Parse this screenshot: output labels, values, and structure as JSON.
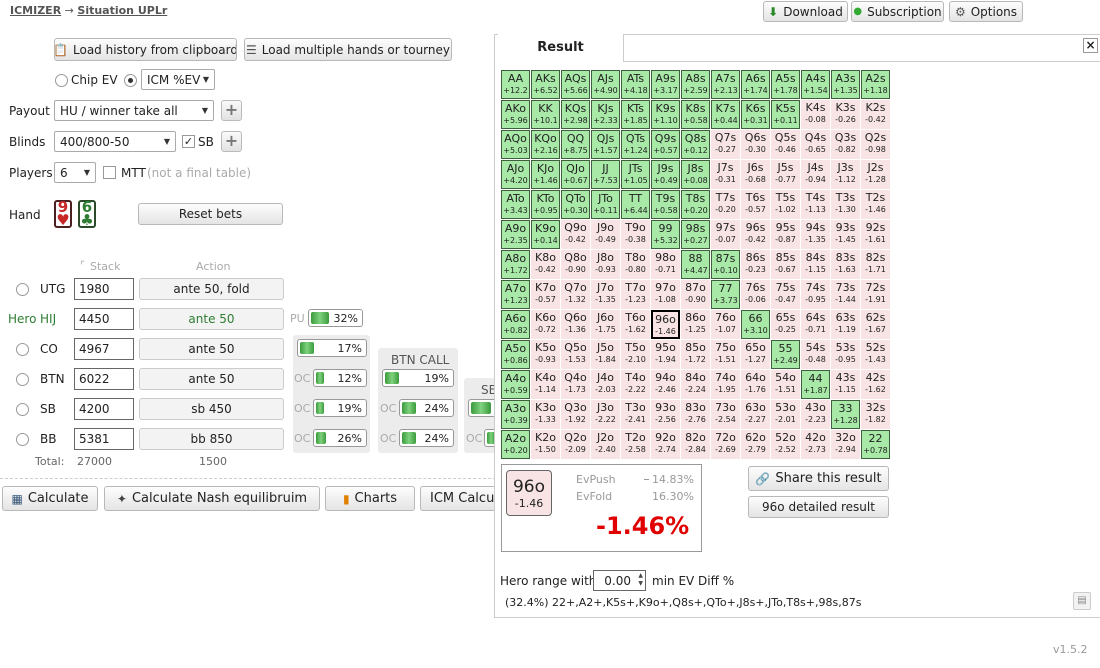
{
  "breadcrumb": {
    "app": "ICMIZER",
    "arrow": "→",
    "page": "Situation UPLr"
  },
  "top_buttons": {
    "download": "Download",
    "subscription": "Subscription",
    "options": "Options"
  },
  "load_buttons": {
    "history": "Load history from clipboard",
    "multi": "Load multiple hands or tourney"
  },
  "ev_mode": {
    "chip": "Chip EV",
    "icm": "ICM %EV",
    "selected": "icm"
  },
  "settings": {
    "payout_label": "Payout",
    "payout_value": "HU / winner take all",
    "blinds_label": "Blinds",
    "blinds_value": "400/800-50",
    "sb_label": "SB",
    "sb_checked": true,
    "players_label": "Players",
    "players_value": "6",
    "mtt_label": "MTT",
    "mtt_note": "(not a final table)"
  },
  "hand": {
    "label": "Hand",
    "card1": {
      "rank": "9",
      "suit": "♥",
      "color": "#c62828"
    },
    "card2": {
      "rank": "6",
      "suit": "♣",
      "color": "#2e7d32"
    },
    "reset": "Reset bets"
  },
  "table_headers": {
    "stack": "Stack",
    "action": "Action"
  },
  "players": [
    {
      "pos": "UTG",
      "hero": false,
      "stack": "1980",
      "action": "ante 50, fold"
    },
    {
      "pos": "HIJ",
      "hero": true,
      "hero_label": "Hero",
      "stack": "4450",
      "action": "ante 50"
    },
    {
      "pos": "CO",
      "hero": false,
      "stack": "4967",
      "action": "ante 50"
    },
    {
      "pos": "BTN",
      "hero": false,
      "stack": "6022",
      "action": "ante 50"
    },
    {
      "pos": "SB",
      "hero": false,
      "stack": "4200",
      "action": "sb 450"
    },
    {
      "pos": "BB",
      "hero": false,
      "stack": "5381",
      "action": "bb 850"
    }
  ],
  "totals": {
    "label": "Total:",
    "stack": "27000",
    "action": "1500"
  },
  "ranges": {
    "pu_label": "PU",
    "pu_pct": "32%",
    "oc_label": "OC",
    "btn_call": "BTN CALL",
    "se_label": "SE",
    "co": [
      "17%",
      "12%",
      "19%",
      "26%"
    ],
    "btn": [
      "19%",
      "24%",
      "24%"
    ]
  },
  "bottom_buttons": {
    "calculate": "Calculate",
    "nash": "Calculate Nash equilibruim",
    "charts": "Charts",
    "icm": "ICM Calcu"
  },
  "result": {
    "tab": "Result",
    "close": "×",
    "grid": [
      [
        [
          "AA",
          "+12.2",
          1
        ],
        [
          "AKs",
          "+6.52",
          1
        ],
        [
          "AQs",
          "+5.66",
          1
        ],
        [
          "AJs",
          "+4.90",
          1
        ],
        [
          "ATs",
          "+4.18",
          1
        ],
        [
          "A9s",
          "+3.17",
          1
        ],
        [
          "A8s",
          "+2.59",
          1
        ],
        [
          "A7s",
          "+2.13",
          1
        ],
        [
          "A6s",
          "+1.74",
          1
        ],
        [
          "A5s",
          "+1.78",
          1
        ],
        [
          "A4s",
          "+1.54",
          1
        ],
        [
          "A3s",
          "+1.35",
          1
        ],
        [
          "A2s",
          "+1.18",
          1
        ]
      ],
      [
        [
          "AKo",
          "+5.96",
          1
        ],
        [
          "KK",
          "+10.1",
          1
        ],
        [
          "KQs",
          "+2.98",
          1
        ],
        [
          "KJs",
          "+2.33",
          1
        ],
        [
          "KTs",
          "+1.85",
          1
        ],
        [
          "K9s",
          "+1.10",
          1
        ],
        [
          "K8s",
          "+0.58",
          1
        ],
        [
          "K7s",
          "+0.44",
          1
        ],
        [
          "K6s",
          "+0.31",
          1
        ],
        [
          "K5s",
          "+0.11",
          1
        ],
        [
          "K4s",
          "-0.08",
          0
        ],
        [
          "K3s",
          "-0.26",
          0
        ],
        [
          "K2s",
          "-0.42",
          0
        ]
      ],
      [
        [
          "AQo",
          "+5.03",
          1
        ],
        [
          "KQo",
          "+2.16",
          1
        ],
        [
          "QQ",
          "+8.75",
          1
        ],
        [
          "QJs",
          "+1.57",
          1
        ],
        [
          "QTs",
          "+1.24",
          1
        ],
        [
          "Q9s",
          "+0.57",
          1
        ],
        [
          "Q8s",
          "+0.12",
          1
        ],
        [
          "Q7s",
          "-0.27",
          0
        ],
        [
          "Q6s",
          "-0.30",
          0
        ],
        [
          "Q5s",
          "-0.46",
          0
        ],
        [
          "Q4s",
          "-0.65",
          0
        ],
        [
          "Q3s",
          "-0.82",
          0
        ],
        [
          "Q2s",
          "-0.98",
          0
        ]
      ],
      [
        [
          "AJo",
          "+4.20",
          1
        ],
        [
          "KJo",
          "+1.46",
          1
        ],
        [
          "QJo",
          "+0.67",
          1
        ],
        [
          "JJ",
          "+7.53",
          1
        ],
        [
          "JTs",
          "+1.05",
          1
        ],
        [
          "J9s",
          "+0.49",
          1
        ],
        [
          "J8s",
          "+0.08",
          1
        ],
        [
          "J7s",
          "-0.31",
          0
        ],
        [
          "J6s",
          "-0.68",
          0
        ],
        [
          "J5s",
          "-0.77",
          0
        ],
        [
          "J4s",
          "-0.94",
          0
        ],
        [
          "J3s",
          "-1.12",
          0
        ],
        [
          "J2s",
          "-1.28",
          0
        ]
      ],
      [
        [
          "ATo",
          "+3.43",
          1
        ],
        [
          "KTo",
          "+0.95",
          1
        ],
        [
          "QTo",
          "+0.30",
          1
        ],
        [
          "JTo",
          "+0.11",
          1
        ],
        [
          "TT",
          "+6.44",
          1
        ],
        [
          "T9s",
          "+0.58",
          1
        ],
        [
          "T8s",
          "+0.20",
          1
        ],
        [
          "T7s",
          "-0.20",
          0
        ],
        [
          "T6s",
          "-0.57",
          0
        ],
        [
          "T5s",
          "-1.02",
          0
        ],
        [
          "T4s",
          "-1.13",
          0
        ],
        [
          "T3s",
          "-1.30",
          0
        ],
        [
          "T2s",
          "-1.46",
          0
        ]
      ],
      [
        [
          "A9o",
          "+2.35",
          1
        ],
        [
          "K9o",
          "+0.14",
          1
        ],
        [
          "Q9o",
          "-0.42",
          0
        ],
        [
          "J9o",
          "-0.49",
          0
        ],
        [
          "T9o",
          "-0.38",
          0
        ],
        [
          "99",
          "+5.32",
          1
        ],
        [
          "98s",
          "+0.27",
          1
        ],
        [
          "97s",
          "-0.07",
          0
        ],
        [
          "96s",
          "-0.42",
          0
        ],
        [
          "95s",
          "-0.87",
          0
        ],
        [
          "94s",
          "-1.35",
          0
        ],
        [
          "93s",
          "-1.45",
          0
        ],
        [
          "92s",
          "-1.61",
          0
        ]
      ],
      [
        [
          "A8o",
          "+1.72",
          1
        ],
        [
          "K8o",
          "-0.42",
          0
        ],
        [
          "Q8o",
          "-0.90",
          0
        ],
        [
          "J8o",
          "-0.93",
          0
        ],
        [
          "T8o",
          "-0.80",
          0
        ],
        [
          "98o",
          "-0.71",
          0
        ],
        [
          "88",
          "+4.47",
          1
        ],
        [
          "87s",
          "+0.10",
          1
        ],
        [
          "86s",
          "-0.23",
          0
        ],
        [
          "85s",
          "-0.67",
          0
        ],
        [
          "84s",
          "-1.15",
          0
        ],
        [
          "83s",
          "-1.63",
          0
        ],
        [
          "82s",
          "-1.71",
          0
        ]
      ],
      [
        [
          "A7o",
          "+1.23",
          1
        ],
        [
          "K7o",
          "-0.57",
          0
        ],
        [
          "Q7o",
          "-1.32",
          0
        ],
        [
          "J7o",
          "-1.35",
          0
        ],
        [
          "T7o",
          "-1.23",
          0
        ],
        [
          "97o",
          "-1.08",
          0
        ],
        [
          "87o",
          "-0.90",
          0
        ],
        [
          "77",
          "+3.73",
          1
        ],
        [
          "76s",
          "-0.06",
          0
        ],
        [
          "75s",
          "-0.47",
          0
        ],
        [
          "74s",
          "-0.95",
          0
        ],
        [
          "73s",
          "-1.44",
          0
        ],
        [
          "72s",
          "-1.91",
          0
        ]
      ],
      [
        [
          "A6o",
          "+0.82",
          1
        ],
        [
          "K6o",
          "-0.72",
          0
        ],
        [
          "Q6o",
          "-1.36",
          0
        ],
        [
          "J6o",
          "-1.75",
          0
        ],
        [
          "T6o",
          "-1.62",
          0
        ],
        [
          "96o",
          "-1.46",
          2
        ],
        [
          "86o",
          "-1.25",
          0
        ],
        [
          "76o",
          "-1.07",
          0
        ],
        [
          "66",
          "+3.10",
          1
        ],
        [
          "65s",
          "-0.25",
          0
        ],
        [
          "64s",
          "-0.71",
          0
        ],
        [
          "63s",
          "-1.19",
          0
        ],
        [
          "62s",
          "-1.67",
          0
        ]
      ],
      [
        [
          "A5o",
          "+0.86",
          1
        ],
        [
          "K5o",
          "-0.93",
          0
        ],
        [
          "Q5o",
          "-1.53",
          0
        ],
        [
          "J5o",
          "-1.84",
          0
        ],
        [
          "T5o",
          "-2.10",
          0
        ],
        [
          "95o",
          "-1.94",
          0
        ],
        [
          "85o",
          "-1.72",
          0
        ],
        [
          "75o",
          "-1.51",
          0
        ],
        [
          "65o",
          "-1.27",
          0
        ],
        [
          "55",
          "+2.49",
          1
        ],
        [
          "54s",
          "-0.48",
          0
        ],
        [
          "53s",
          "-0.95",
          0
        ],
        [
          "52s",
          "-1.43",
          0
        ]
      ],
      [
        [
          "A4o",
          "+0.59",
          1
        ],
        [
          "K4o",
          "-1.14",
          0
        ],
        [
          "Q4o",
          "-1.73",
          0
        ],
        [
          "J4o",
          "-2.03",
          0
        ],
        [
          "T4o",
          "-2.22",
          0
        ],
        [
          "94o",
          "-2.46",
          0
        ],
        [
          "84o",
          "-2.24",
          0
        ],
        [
          "74o",
          "-1.95",
          0
        ],
        [
          "64o",
          "-1.76",
          0
        ],
        [
          "54o",
          "-1.51",
          0
        ],
        [
          "44",
          "+1.87",
          1
        ],
        [
          "43s",
          "-1.15",
          0
        ],
        [
          "42s",
          "-1.62",
          0
        ]
      ],
      [
        [
          "A3o",
          "+0.39",
          1
        ],
        [
          "K3o",
          "-1.33",
          0
        ],
        [
          "Q3o",
          "-1.92",
          0
        ],
        [
          "J3o",
          "-2.22",
          0
        ],
        [
          "T3o",
          "-2.41",
          0
        ],
        [
          "93o",
          "-2.56",
          0
        ],
        [
          "83o",
          "-2.76",
          0
        ],
        [
          "73o",
          "-2.54",
          0
        ],
        [
          "63o",
          "-2.27",
          0
        ],
        [
          "53o",
          "-2.01",
          0
        ],
        [
          "43o",
          "-2.23",
          0
        ],
        [
          "33",
          "+1.28",
          1
        ],
        [
          "32s",
          "-1.82",
          0
        ]
      ],
      [
        [
          "A2o",
          "+0.20",
          1
        ],
        [
          "K2o",
          "-1.50",
          0
        ],
        [
          "Q2o",
          "-2.09",
          0
        ],
        [
          "J2o",
          "-2.40",
          0
        ],
        [
          "T2o",
          "-2.58",
          0
        ],
        [
          "92o",
          "-2.74",
          0
        ],
        [
          "82o",
          "-2.84",
          0
        ],
        [
          "72o",
          "-2.69",
          0
        ],
        [
          "62o",
          "-2.79",
          0
        ],
        [
          "52o",
          "-2.52",
          0
        ],
        [
          "42o",
          "-2.73",
          0
        ],
        [
          "32o",
          "-2.94",
          0
        ],
        [
          "22",
          "+0.78",
          1
        ]
      ]
    ],
    "selected_hand": "96o",
    "selected_diff": "-1.46",
    "ev_push_label": "EvPush",
    "ev_push": "14.83%",
    "ev_fold_label": "EvFold",
    "ev_fold": "16.30%",
    "big_diff": "-1.46%",
    "share": "Share this result",
    "detailed": "96o detailed result",
    "hero_range_label": "Hero range with",
    "min_ev": "0.00",
    "min_ev_label": "min EV Diff %",
    "range_text": "(32.4%) 22+,A2+,K5s+,K9o+,Q8s+,QTo+,J8s+,JTo,T8s+,98s,87s"
  },
  "version": "v1.5.2",
  "colors": {
    "push": "#a8e9a8",
    "fold": "#f8e4e4",
    "negative": "#e00000"
  }
}
